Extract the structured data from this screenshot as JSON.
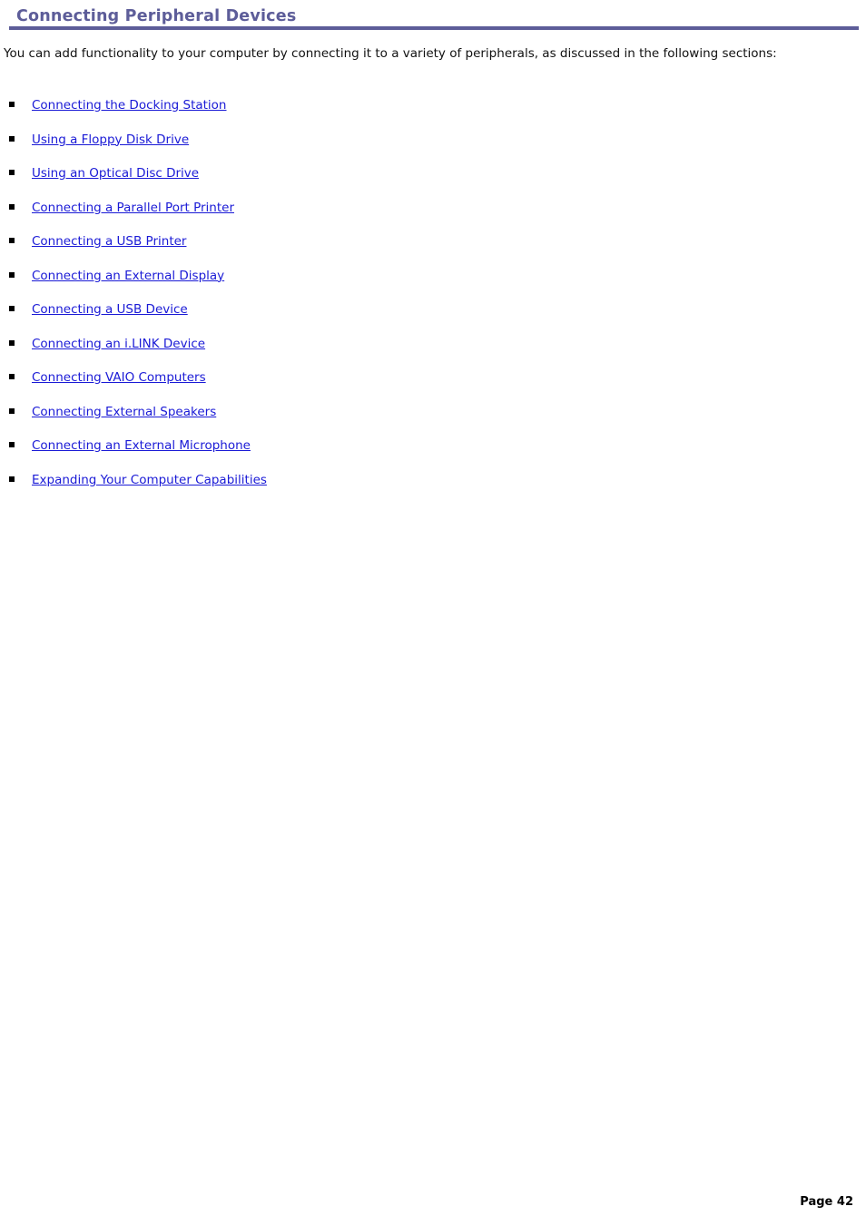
{
  "document": {
    "heading": "Connecting Peripheral Devices",
    "intro": "You can add functionality to your computer by connecting it to a variety of peripherals, as discussed in the following sections:",
    "links": [
      {
        "label": "Connecting the Docking Station"
      },
      {
        "label": "Using a Floppy Disk Drive"
      },
      {
        "label": "Using an Optical Disc Drive"
      },
      {
        "label": "Connecting a Parallel Port Printer"
      },
      {
        "label": "Connecting a USB Printer"
      },
      {
        "label": "Connecting an External Display"
      },
      {
        "label": "Connecting a USB Device"
      },
      {
        "label": "Connecting an i.LINK Device"
      },
      {
        "label": "Connecting VAIO Computers"
      },
      {
        "label": "Connecting External Speakers"
      },
      {
        "label": "Connecting an External Microphone"
      },
      {
        "label": "Expanding Your Computer Capabilities"
      }
    ],
    "footer": {
      "page_number": "Page 42"
    },
    "colors": {
      "heading": "#5d5d99",
      "rule": "#5d5d99",
      "link": "#1a1ad6",
      "body_text": "#111111",
      "background": "#ffffff",
      "bullet": "#000000"
    }
  }
}
